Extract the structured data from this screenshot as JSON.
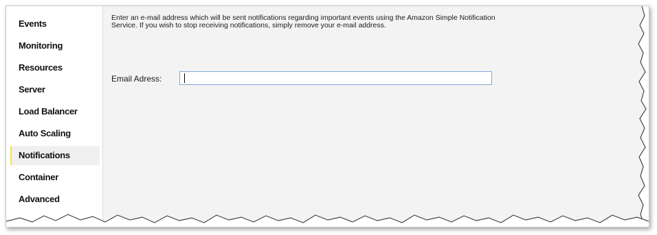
{
  "sidebar": {
    "items": [
      {
        "label": "Events",
        "active": false
      },
      {
        "label": "Monitoring",
        "active": false
      },
      {
        "label": "Resources",
        "active": false
      },
      {
        "label": "Server",
        "active": false
      },
      {
        "label": "Load Balancer",
        "active": false
      },
      {
        "label": "Auto Scaling",
        "active": false
      },
      {
        "label": "Notifications",
        "active": true
      },
      {
        "label": "Container",
        "active": false
      },
      {
        "label": "Advanced",
        "active": false
      }
    ]
  },
  "main": {
    "description": "Enter an e-mail address which will be sent notifications regarding important events using the Amazon Simple Notification Service. If you wish to stop receiving notifications, simply remove your e-mail address.",
    "email_label": "Email Adress:",
    "email_value": ""
  },
  "colors": {
    "content_background": "#f3f3f3",
    "active_item_background": "#f0f0f0",
    "active_item_marker": "#f5e34a",
    "input_border": "#7aa7d6"
  }
}
